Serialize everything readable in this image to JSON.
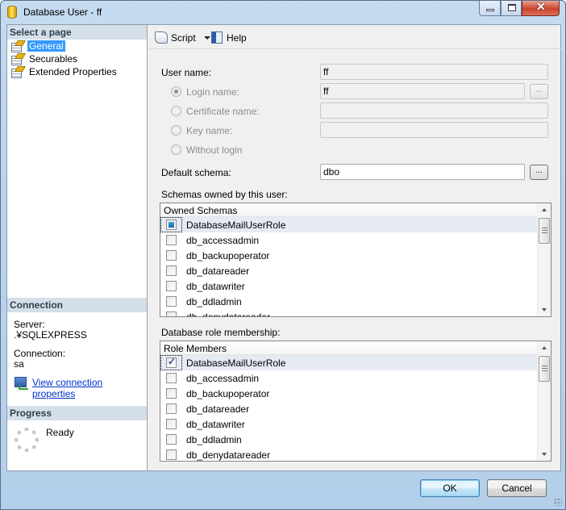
{
  "window": {
    "title": "Database User - ff",
    "controls": {
      "minimize": "minimize",
      "maximize": "maximize",
      "close": "close"
    }
  },
  "left_pane": {
    "select_page_header": "Select a page",
    "pages": [
      {
        "label": "General",
        "selected": true
      },
      {
        "label": "Securables",
        "selected": false
      },
      {
        "label": "Extended Properties",
        "selected": false
      }
    ],
    "connection_header": "Connection",
    "server_label": "Server:",
    "server_value": ".¥SQLEXPRESS",
    "connection_label": "Connection:",
    "connection_value": "sa",
    "view_connection_link": "View connection properties",
    "progress_header": "Progress",
    "progress_status": "Ready"
  },
  "toolbar": {
    "script_label": "Script",
    "help_label": "Help"
  },
  "form": {
    "user_name_label": "User name:",
    "user_name_value": "ff",
    "login_name_label": "Login name:",
    "login_name_value": "ff",
    "certificate_name_label": "Certificate name:",
    "certificate_name_value": "",
    "key_name_label": "Key name:",
    "key_name_value": "",
    "without_login_label": "Without login",
    "selected_user_type": "Login name",
    "ellipsis_label": "...",
    "default_schema_label": "Default schema:",
    "default_schema_value": "dbo"
  },
  "owned_schemas": {
    "section_label": "Schemas owned by this user:",
    "column_header": "Owned Schemas",
    "rows": [
      {
        "label": "DatabaseMailUserRole",
        "state": "indeterminate",
        "selected": true
      },
      {
        "label": "db_accessadmin",
        "state": "unchecked"
      },
      {
        "label": "db_backupoperator",
        "state": "unchecked"
      },
      {
        "label": "db_datareader",
        "state": "unchecked"
      },
      {
        "label": "db_datawriter",
        "state": "unchecked"
      },
      {
        "label": "db_ddladmin",
        "state": "unchecked"
      },
      {
        "label": "db_denydatareader",
        "state": "unchecked"
      }
    ]
  },
  "role_membership": {
    "section_label": "Database role membership:",
    "column_header": "Role Members",
    "rows": [
      {
        "label": "DatabaseMailUserRole",
        "state": "checked",
        "selected": true
      },
      {
        "label": "db_accessadmin",
        "state": "unchecked"
      },
      {
        "label": "db_backupoperator",
        "state": "unchecked"
      },
      {
        "label": "db_datareader",
        "state": "unchecked"
      },
      {
        "label": "db_datawriter",
        "state": "unchecked"
      },
      {
        "label": "db_ddladmin",
        "state": "unchecked"
      },
      {
        "label": "db_denydatareader",
        "state": "unchecked"
      }
    ]
  },
  "buttons": {
    "ok": "OK",
    "cancel": "Cancel"
  }
}
